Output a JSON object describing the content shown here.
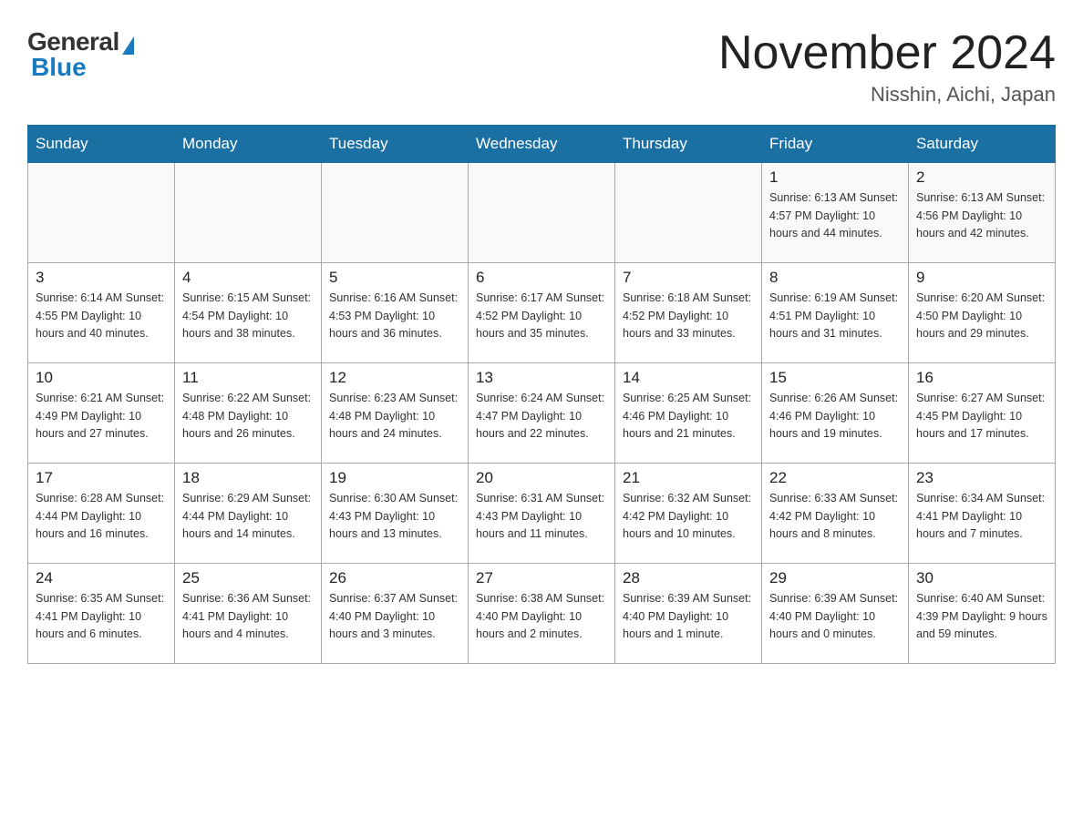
{
  "header": {
    "logo_general": "General",
    "logo_blue": "Blue",
    "title": "November 2024",
    "subtitle": "Nisshin, Aichi, Japan"
  },
  "weekdays": [
    "Sunday",
    "Monday",
    "Tuesday",
    "Wednesday",
    "Thursday",
    "Friday",
    "Saturday"
  ],
  "weeks": [
    [
      {
        "day": "",
        "info": ""
      },
      {
        "day": "",
        "info": ""
      },
      {
        "day": "",
        "info": ""
      },
      {
        "day": "",
        "info": ""
      },
      {
        "day": "",
        "info": ""
      },
      {
        "day": "1",
        "info": "Sunrise: 6:13 AM\nSunset: 4:57 PM\nDaylight: 10 hours\nand 44 minutes."
      },
      {
        "day": "2",
        "info": "Sunrise: 6:13 AM\nSunset: 4:56 PM\nDaylight: 10 hours\nand 42 minutes."
      }
    ],
    [
      {
        "day": "3",
        "info": "Sunrise: 6:14 AM\nSunset: 4:55 PM\nDaylight: 10 hours\nand 40 minutes."
      },
      {
        "day": "4",
        "info": "Sunrise: 6:15 AM\nSunset: 4:54 PM\nDaylight: 10 hours\nand 38 minutes."
      },
      {
        "day": "5",
        "info": "Sunrise: 6:16 AM\nSunset: 4:53 PM\nDaylight: 10 hours\nand 36 minutes."
      },
      {
        "day": "6",
        "info": "Sunrise: 6:17 AM\nSunset: 4:52 PM\nDaylight: 10 hours\nand 35 minutes."
      },
      {
        "day": "7",
        "info": "Sunrise: 6:18 AM\nSunset: 4:52 PM\nDaylight: 10 hours\nand 33 minutes."
      },
      {
        "day": "8",
        "info": "Sunrise: 6:19 AM\nSunset: 4:51 PM\nDaylight: 10 hours\nand 31 minutes."
      },
      {
        "day": "9",
        "info": "Sunrise: 6:20 AM\nSunset: 4:50 PM\nDaylight: 10 hours\nand 29 minutes."
      }
    ],
    [
      {
        "day": "10",
        "info": "Sunrise: 6:21 AM\nSunset: 4:49 PM\nDaylight: 10 hours\nand 27 minutes."
      },
      {
        "day": "11",
        "info": "Sunrise: 6:22 AM\nSunset: 4:48 PM\nDaylight: 10 hours\nand 26 minutes."
      },
      {
        "day": "12",
        "info": "Sunrise: 6:23 AM\nSunset: 4:48 PM\nDaylight: 10 hours\nand 24 minutes."
      },
      {
        "day": "13",
        "info": "Sunrise: 6:24 AM\nSunset: 4:47 PM\nDaylight: 10 hours\nand 22 minutes."
      },
      {
        "day": "14",
        "info": "Sunrise: 6:25 AM\nSunset: 4:46 PM\nDaylight: 10 hours\nand 21 minutes."
      },
      {
        "day": "15",
        "info": "Sunrise: 6:26 AM\nSunset: 4:46 PM\nDaylight: 10 hours\nand 19 minutes."
      },
      {
        "day": "16",
        "info": "Sunrise: 6:27 AM\nSunset: 4:45 PM\nDaylight: 10 hours\nand 17 minutes."
      }
    ],
    [
      {
        "day": "17",
        "info": "Sunrise: 6:28 AM\nSunset: 4:44 PM\nDaylight: 10 hours\nand 16 minutes."
      },
      {
        "day": "18",
        "info": "Sunrise: 6:29 AM\nSunset: 4:44 PM\nDaylight: 10 hours\nand 14 minutes."
      },
      {
        "day": "19",
        "info": "Sunrise: 6:30 AM\nSunset: 4:43 PM\nDaylight: 10 hours\nand 13 minutes."
      },
      {
        "day": "20",
        "info": "Sunrise: 6:31 AM\nSunset: 4:43 PM\nDaylight: 10 hours\nand 11 minutes."
      },
      {
        "day": "21",
        "info": "Sunrise: 6:32 AM\nSunset: 4:42 PM\nDaylight: 10 hours\nand 10 minutes."
      },
      {
        "day": "22",
        "info": "Sunrise: 6:33 AM\nSunset: 4:42 PM\nDaylight: 10 hours\nand 8 minutes."
      },
      {
        "day": "23",
        "info": "Sunrise: 6:34 AM\nSunset: 4:41 PM\nDaylight: 10 hours\nand 7 minutes."
      }
    ],
    [
      {
        "day": "24",
        "info": "Sunrise: 6:35 AM\nSunset: 4:41 PM\nDaylight: 10 hours\nand 6 minutes."
      },
      {
        "day": "25",
        "info": "Sunrise: 6:36 AM\nSunset: 4:41 PM\nDaylight: 10 hours\nand 4 minutes."
      },
      {
        "day": "26",
        "info": "Sunrise: 6:37 AM\nSunset: 4:40 PM\nDaylight: 10 hours\nand 3 minutes."
      },
      {
        "day": "27",
        "info": "Sunrise: 6:38 AM\nSunset: 4:40 PM\nDaylight: 10 hours\nand 2 minutes."
      },
      {
        "day": "28",
        "info": "Sunrise: 6:39 AM\nSunset: 4:40 PM\nDaylight: 10 hours\nand 1 minute."
      },
      {
        "day": "29",
        "info": "Sunrise: 6:39 AM\nSunset: 4:40 PM\nDaylight: 10 hours\nand 0 minutes."
      },
      {
        "day": "30",
        "info": "Sunrise: 6:40 AM\nSunset: 4:39 PM\nDaylight: 9 hours\nand 59 minutes."
      }
    ]
  ]
}
